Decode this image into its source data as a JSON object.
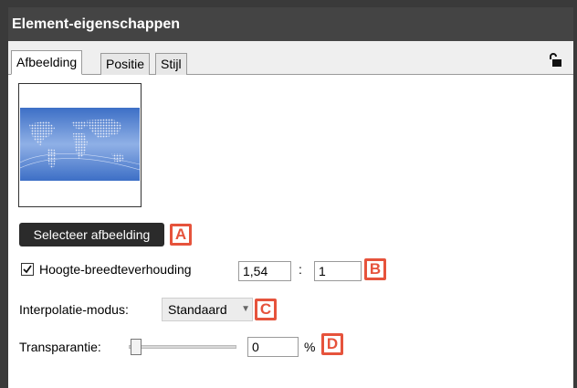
{
  "panel": {
    "title": "Element-eigenschappen"
  },
  "tabs": [
    {
      "label": "Afbeelding",
      "active": true
    },
    {
      "label": "Positie",
      "active": false
    },
    {
      "label": "Stijl",
      "active": false
    }
  ],
  "image_section": {
    "select_button": "Selecteer afbeelding"
  },
  "aspect_ratio": {
    "checked": true,
    "label": "Hoogte-breedteverhouding",
    "value_left": "1,54",
    "separator": ":",
    "value_right": "1"
  },
  "interpolation": {
    "label": "Interpolatie-modus:",
    "selected": "Standaard"
  },
  "transparency": {
    "label": "Transparantie:",
    "value": "0",
    "unit": "%",
    "slider_level": 0
  },
  "callouts": {
    "a": "A",
    "b": "B",
    "c": "C",
    "d": "D"
  },
  "colors": {
    "title_bg": "#444444",
    "callout": "#e6533c",
    "button_bg": "#2b2b2b"
  },
  "icons": {
    "lock": "lock-open-icon",
    "checkmark": "checkmark-icon",
    "dropdown": "chevron-down-icon"
  }
}
